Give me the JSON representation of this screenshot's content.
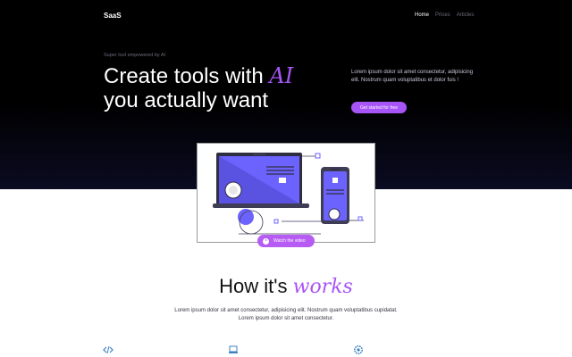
{
  "brand": {
    "name": "SaaS",
    "accent": "#a855f7"
  },
  "nav": {
    "items": [
      {
        "label": "Home",
        "active": true
      },
      {
        "label": "Prices",
        "active": false
      },
      {
        "label": "Articles",
        "active": false
      }
    ]
  },
  "hero": {
    "eyebrow": "Super tool empowered by AI",
    "headline_line1": "Create tools with",
    "headline_ai": "AI",
    "headline_line2": "you actually want",
    "description": "Lorem ipsum dolor sit amet consectetur, adipisicing elit. Nostrum quam voluptatibus et dolor fuis !",
    "cta_label": "Get started for free"
  },
  "illustration": {
    "watch_label": "Watch the video"
  },
  "how": {
    "title_plain": "How it's",
    "title_accent": "works",
    "description": "Lorem ipsum dolor sit amet consectetur, adipisicing elit. Nostrum quam voluptatibus cupidatat. Lorem ipsum dolor sit amet consectetur."
  },
  "features": {
    "icons": [
      "code-icon",
      "laptop-icon",
      "settings-icon"
    ]
  }
}
